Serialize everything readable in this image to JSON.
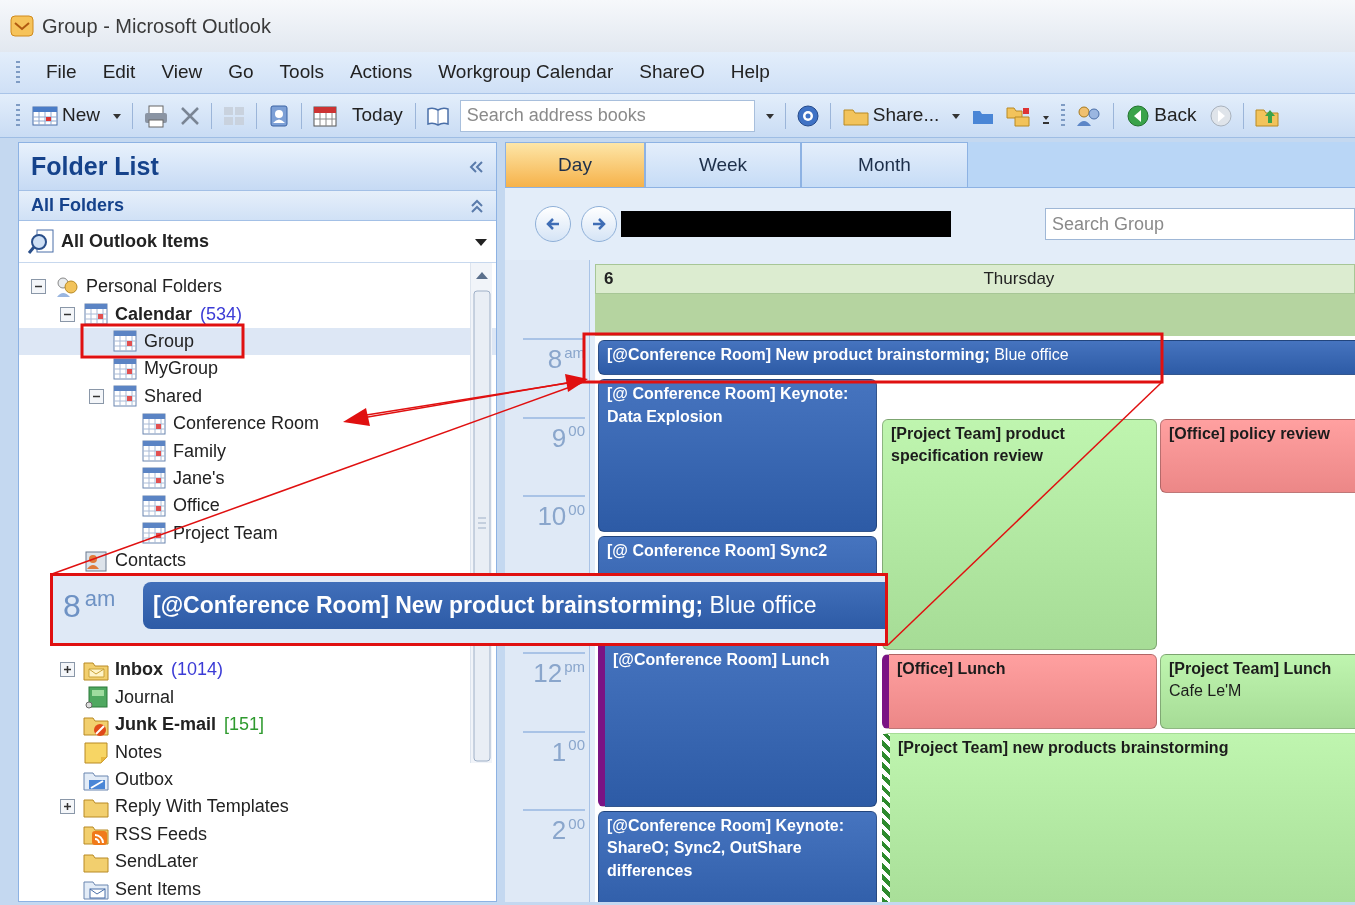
{
  "window": {
    "title": "Group - Microsoft Outlook"
  },
  "menu": [
    "File",
    "Edit",
    "View",
    "Go",
    "Tools",
    "Actions",
    "Workgroup Calendar",
    "ShareO",
    "Help"
  ],
  "toolbar": {
    "new": "New",
    "today": "Today",
    "address_search": {
      "placeholder": "Search address books"
    },
    "share": "Share...",
    "back": "Back"
  },
  "folder_pane": {
    "title": "Folder List",
    "section": "All Folders",
    "view_selector": "All Outlook Items",
    "tree": [
      {
        "label": "Personal Folders",
        "kind": "personal",
        "expanded": true,
        "selected": false,
        "unread": false,
        "children": [
          {
            "label": "Calendar",
            "kind": "calendar",
            "count": {
              "text": "(534)",
              "color": "#3b3bd6"
            },
            "expanded": true,
            "selected": false,
            "unread": true,
            "children": [
              {
                "label": "Group",
                "kind": "calendar",
                "selected": true,
                "unread": false
              },
              {
                "label": "MyGroup",
                "kind": "calendar",
                "selected": false,
                "unread": false
              },
              {
                "label": "Shared",
                "kind": "calendar",
                "expanded": true,
                "selected": false,
                "unread": false,
                "children": [
                  {
                    "label": "Conference Room",
                    "kind": "calendar",
                    "selected": false,
                    "unread": false
                  },
                  {
                    "label": "Family",
                    "kind": "calendar",
                    "selected": false,
                    "unread": false
                  },
                  {
                    "label": "Jane's",
                    "kind": "calendar",
                    "selected": false,
                    "unread": false
                  },
                  {
                    "label": "Office",
                    "kind": "calendar",
                    "selected": false,
                    "unread": false
                  },
                  {
                    "label": "Project Team",
                    "kind": "calendar",
                    "selected": false,
                    "unread": false
                  }
                ]
              }
            ]
          },
          {
            "label": "Contacts",
            "kind": "contacts",
            "selected": false,
            "unread": false
          },
          {
            "label": "Inbox",
            "kind": "inbox",
            "count": {
              "text": "(1014)",
              "color": "#3b3bd6"
            },
            "expanded": false,
            "selected": false,
            "unread": true
          },
          {
            "label": "Journal",
            "kind": "journal",
            "selected": false,
            "unread": false
          },
          {
            "label": "Junk E-mail",
            "kind": "junk",
            "count": {
              "text": "[151]",
              "color": "#2e9a2e"
            },
            "selected": false,
            "unread": true
          },
          {
            "label": "Notes",
            "kind": "notes",
            "selected": false,
            "unread": false
          },
          {
            "label": "Outbox",
            "kind": "outbox",
            "selected": false,
            "unread": false
          },
          {
            "label": "Reply With Templates",
            "kind": "folder",
            "expanded": false,
            "selected": false,
            "unread": false
          },
          {
            "label": "RSS Feeds",
            "kind": "rss",
            "selected": false,
            "unread": false
          },
          {
            "label": "SendLater",
            "kind": "folder",
            "selected": false,
            "unread": false
          },
          {
            "label": "Sent Items",
            "kind": "sent",
            "selected": false,
            "unread": false
          }
        ]
      }
    ]
  },
  "calendar": {
    "tabs": [
      {
        "label": "Day",
        "selected": true
      },
      {
        "label": "Week",
        "selected": false
      },
      {
        "label": "Month",
        "selected": false
      }
    ],
    "search": {
      "placeholder": "Search Group"
    },
    "day": {
      "number": "6",
      "name": "Thursday"
    },
    "hours": [
      {
        "hour": "8",
        "suffix": "am"
      },
      {
        "hour": "9",
        "suffix": "00"
      },
      {
        "hour": "10",
        "suffix": "00"
      },
      {
        "hour": "12",
        "suffix": "pm"
      },
      {
        "hour": "1",
        "suffix": "00"
      },
      {
        "hour": "2",
        "suffix": "00"
      }
    ],
    "events": [
      {
        "subject": "[@Conference Room] New product brainstorming;",
        "location": "Blue office",
        "color": "#2d5ba6",
        "out_of_office": false,
        "tentative": false
      },
      {
        "subject": "[@ Conference Room] Keynote: Data Explosion",
        "color": "#2d5ba6",
        "out_of_office": false,
        "tentative": false
      },
      {
        "subject": "[@ Conference Room] Sync2",
        "color": "#2d5ba6",
        "out_of_office": false,
        "tentative": false
      },
      {
        "subject": "[@Conference Room] Lunch",
        "color": "#2d5ba6",
        "out_of_office": true,
        "tentative": false
      },
      {
        "subject": "[@Conference Room] Keynote: ShareO; Sync2, OutShare differences",
        "color": "#2d5ba6",
        "out_of_office": false,
        "tentative": false
      },
      {
        "subject": "[Project Team] product specification review",
        "color": "#a6dc96",
        "out_of_office": false,
        "tentative": false
      },
      {
        "subject": "[Office] policy review",
        "color": "#ec8787",
        "out_of_office": false,
        "tentative": false
      },
      {
        "subject": "[Office] Lunch",
        "color": "#ec8787",
        "out_of_office": true,
        "tentative": false
      },
      {
        "subject": "[Project Team] Lunch",
        "location": "Cafe Le'M",
        "color": "#a6dc96",
        "out_of_office": false,
        "tentative": false
      },
      {
        "subject": "[Project Team] new products brainstorming",
        "color": "#a6dc96",
        "out_of_office": false,
        "tentative": true
      }
    ]
  },
  "callout": {
    "hour": {
      "hour": "8",
      "suffix": "am"
    },
    "event": {
      "subject": "[@Conference Room] New product brainstorming;",
      "location": "Blue office",
      "color": "#2d5ba6"
    }
  }
}
